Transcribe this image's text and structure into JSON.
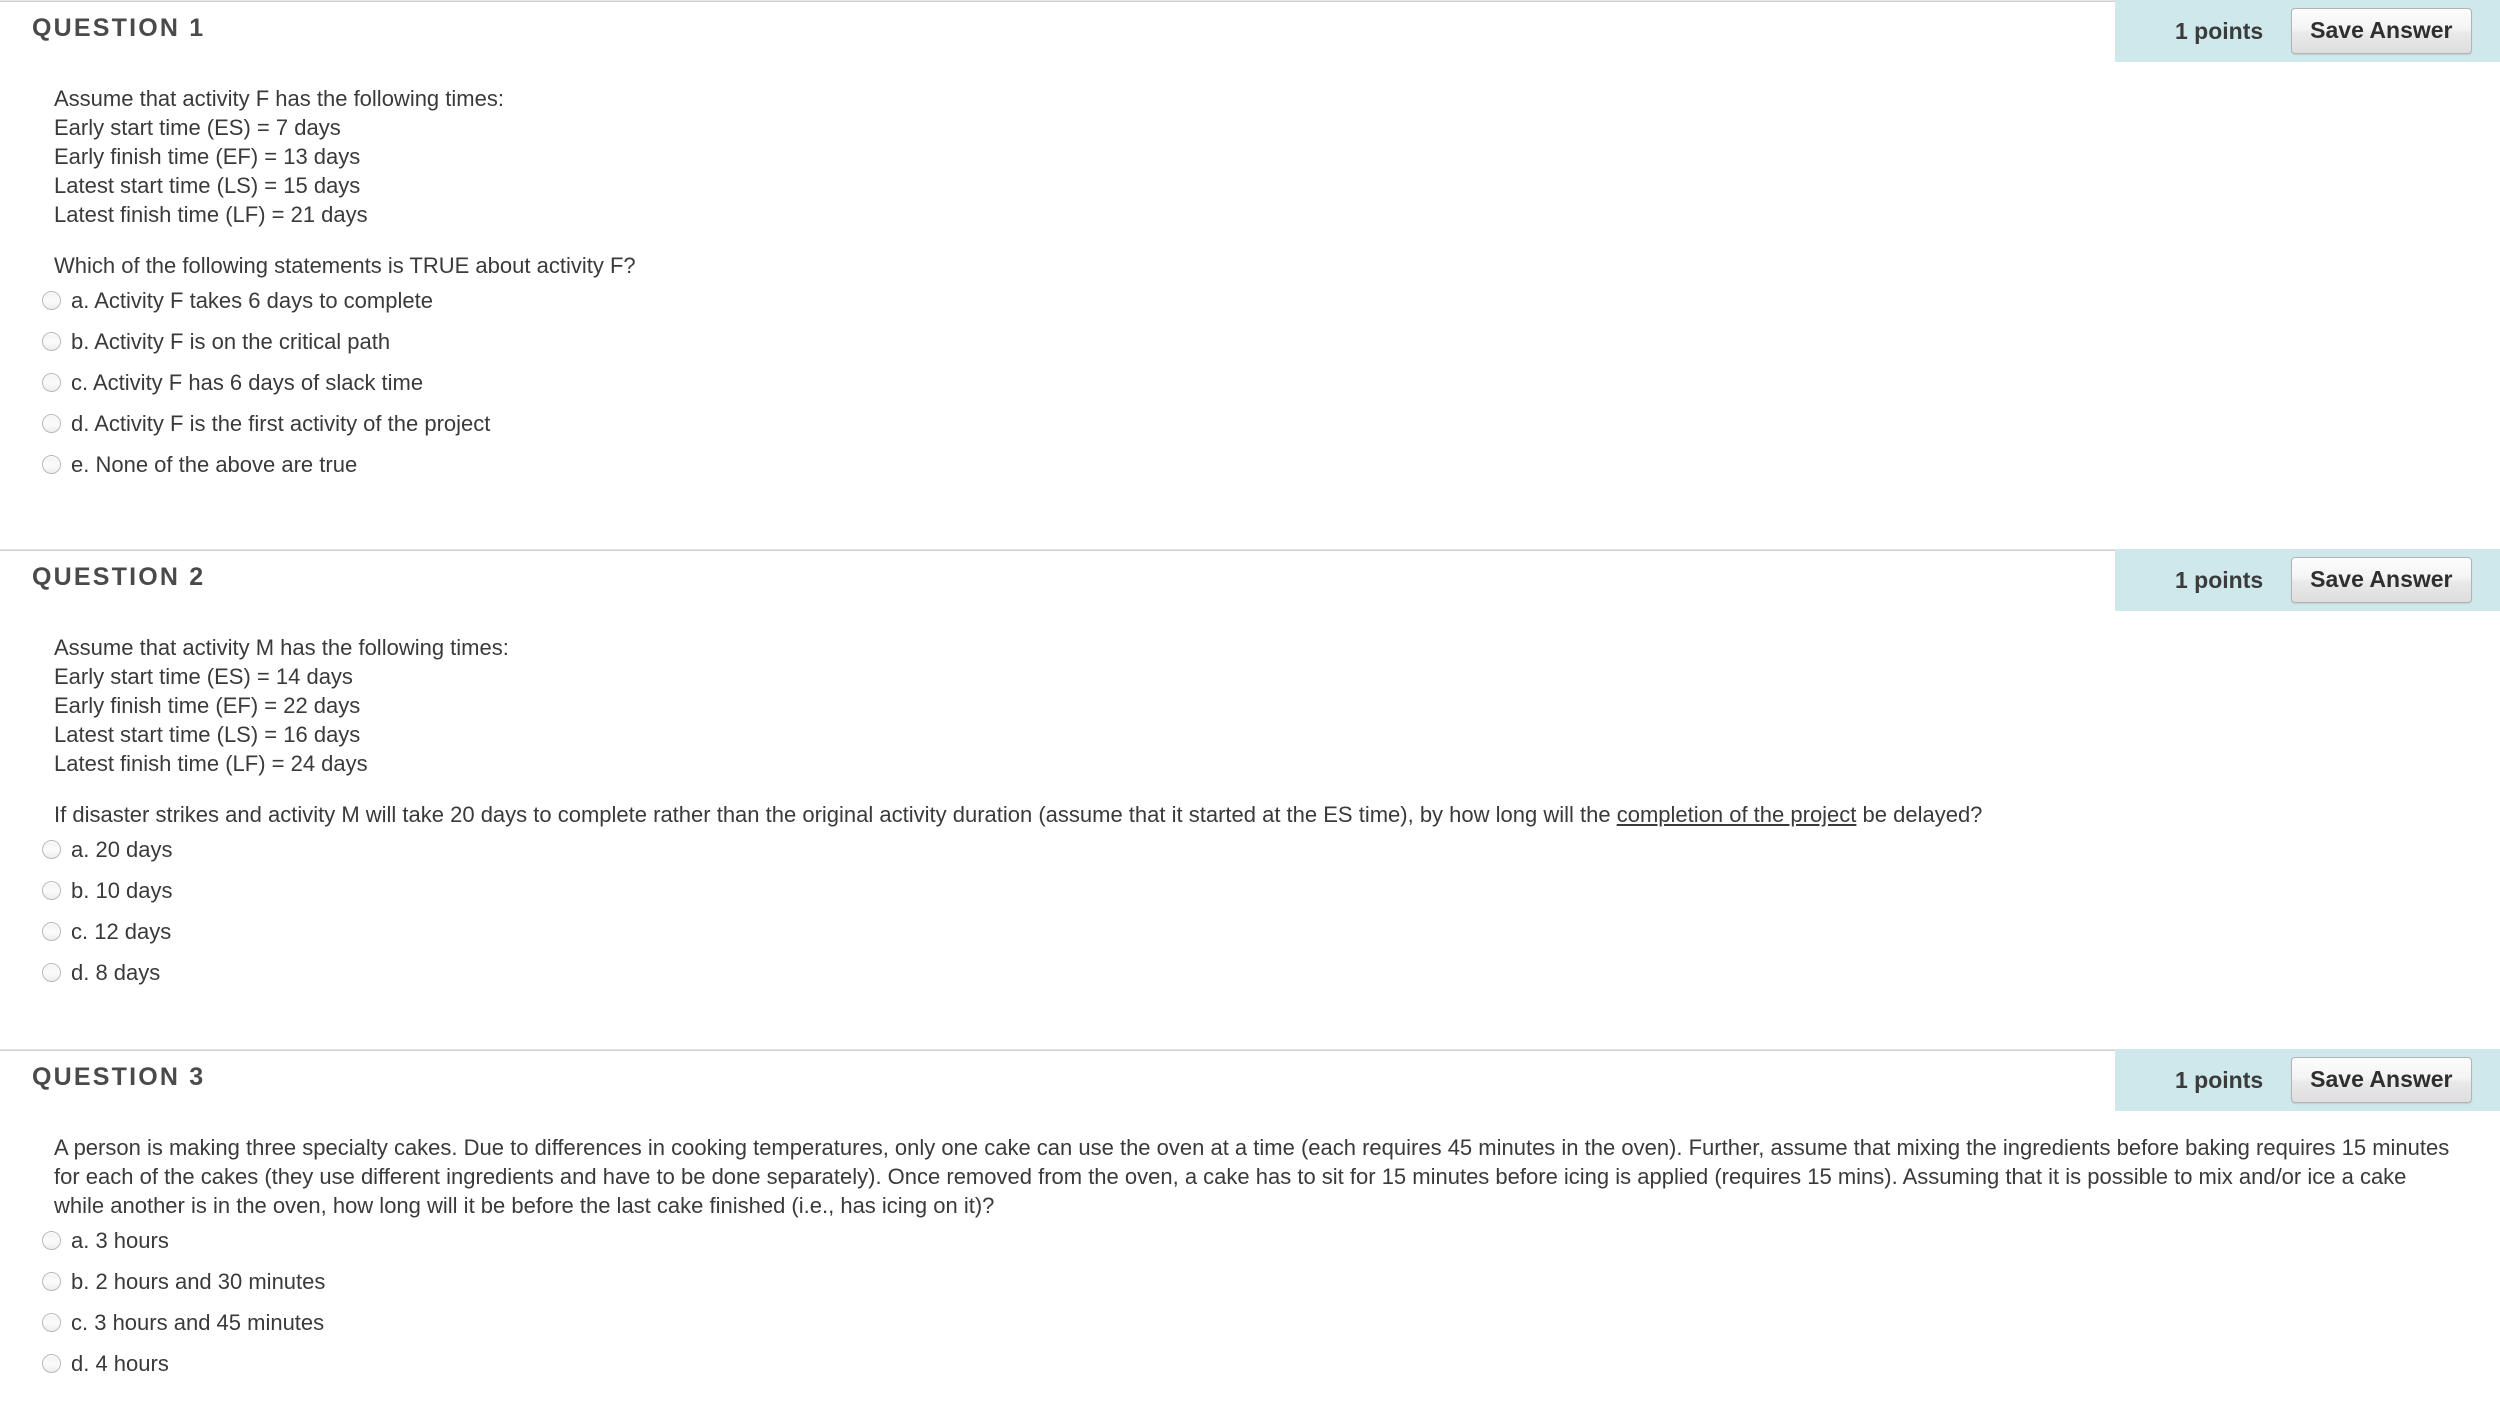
{
  "questions": [
    {
      "title": "QUESTION 1",
      "points_label": "1 points",
      "save_label": "Save Answer",
      "stem": "Assume that activity F has the following times:\nEarly start time (ES) = 7 days\nEarly finish time (EF) = 13 days\nLatest start time (LS) = 15 days\nLatest finish time (LF) = 21 days",
      "prompt": "Which of the following statements is TRUE about activity F?",
      "prompt_underline": "",
      "prompt_tail": "",
      "answers": [
        {
          "label": "a. Activity F takes 6 days to complete",
          "selected": false
        },
        {
          "label": "b. Activity F is on the critical path",
          "selected": false
        },
        {
          "label": "c. Activity F has 6 days of slack time",
          "selected": false
        },
        {
          "label": "d. Activity F is the first activity of the project",
          "selected": false
        },
        {
          "label": "e. None of the above are true",
          "selected": false
        }
      ]
    },
    {
      "title": "QUESTION 2",
      "points_label": "1 points",
      "save_label": "Save Answer",
      "stem": "Assume that activity M has the following times:\nEarly start time (ES) = 14 days\nEarly finish time (EF) = 22 days\nLatest start time (LS) = 16 days\nLatest finish time (LF) = 24 days",
      "prompt": "If disaster strikes and activity M will take 20 days to complete rather than the original activity duration (assume that it started at the ES time), by how long will the ",
      "prompt_underline": "completion of the project",
      "prompt_tail": " be delayed?",
      "answers": [
        {
          "label": "a. 20 days",
          "selected": false
        },
        {
          "label": "b. 10 days",
          "selected": false
        },
        {
          "label": "c. 12 days",
          "selected": false
        },
        {
          "label": "d. 8 days",
          "selected": false
        }
      ]
    },
    {
      "title": "QUESTION 3",
      "points_label": "1 points",
      "save_label": "Save Answer",
      "stem": "",
      "prompt": "A person is making three specialty cakes. Due to differences in cooking temperatures, only one cake can use the oven at a time (each requires 45 minutes in the oven). Further, assume that mixing the ingredients before baking requires 15 minutes for each of the cakes (they use different ingredients and have to be done separately). Once removed from the oven, a cake has to sit for 15 minutes before icing is applied (requires 15 mins). Assuming that it is possible to mix and/or ice a cake while another is in the oven, how long will it be before the last cake finished (i.e., has icing on it)?",
      "prompt_underline": "",
      "prompt_tail": "",
      "answers": [
        {
          "label": "a. 3 hours",
          "selected": false
        },
        {
          "label": "b. 2 hours and 30 minutes",
          "selected": false
        },
        {
          "label": "c. 3 hours and 45 minutes",
          "selected": false
        },
        {
          "label": "d. 4 hours",
          "selected": false
        }
      ]
    }
  ],
  "colors": {
    "meta_bar": "#cfe8ec",
    "rule": "#cfcfcf",
    "text": "#3a3a3a",
    "title": "#4a4a4a"
  }
}
